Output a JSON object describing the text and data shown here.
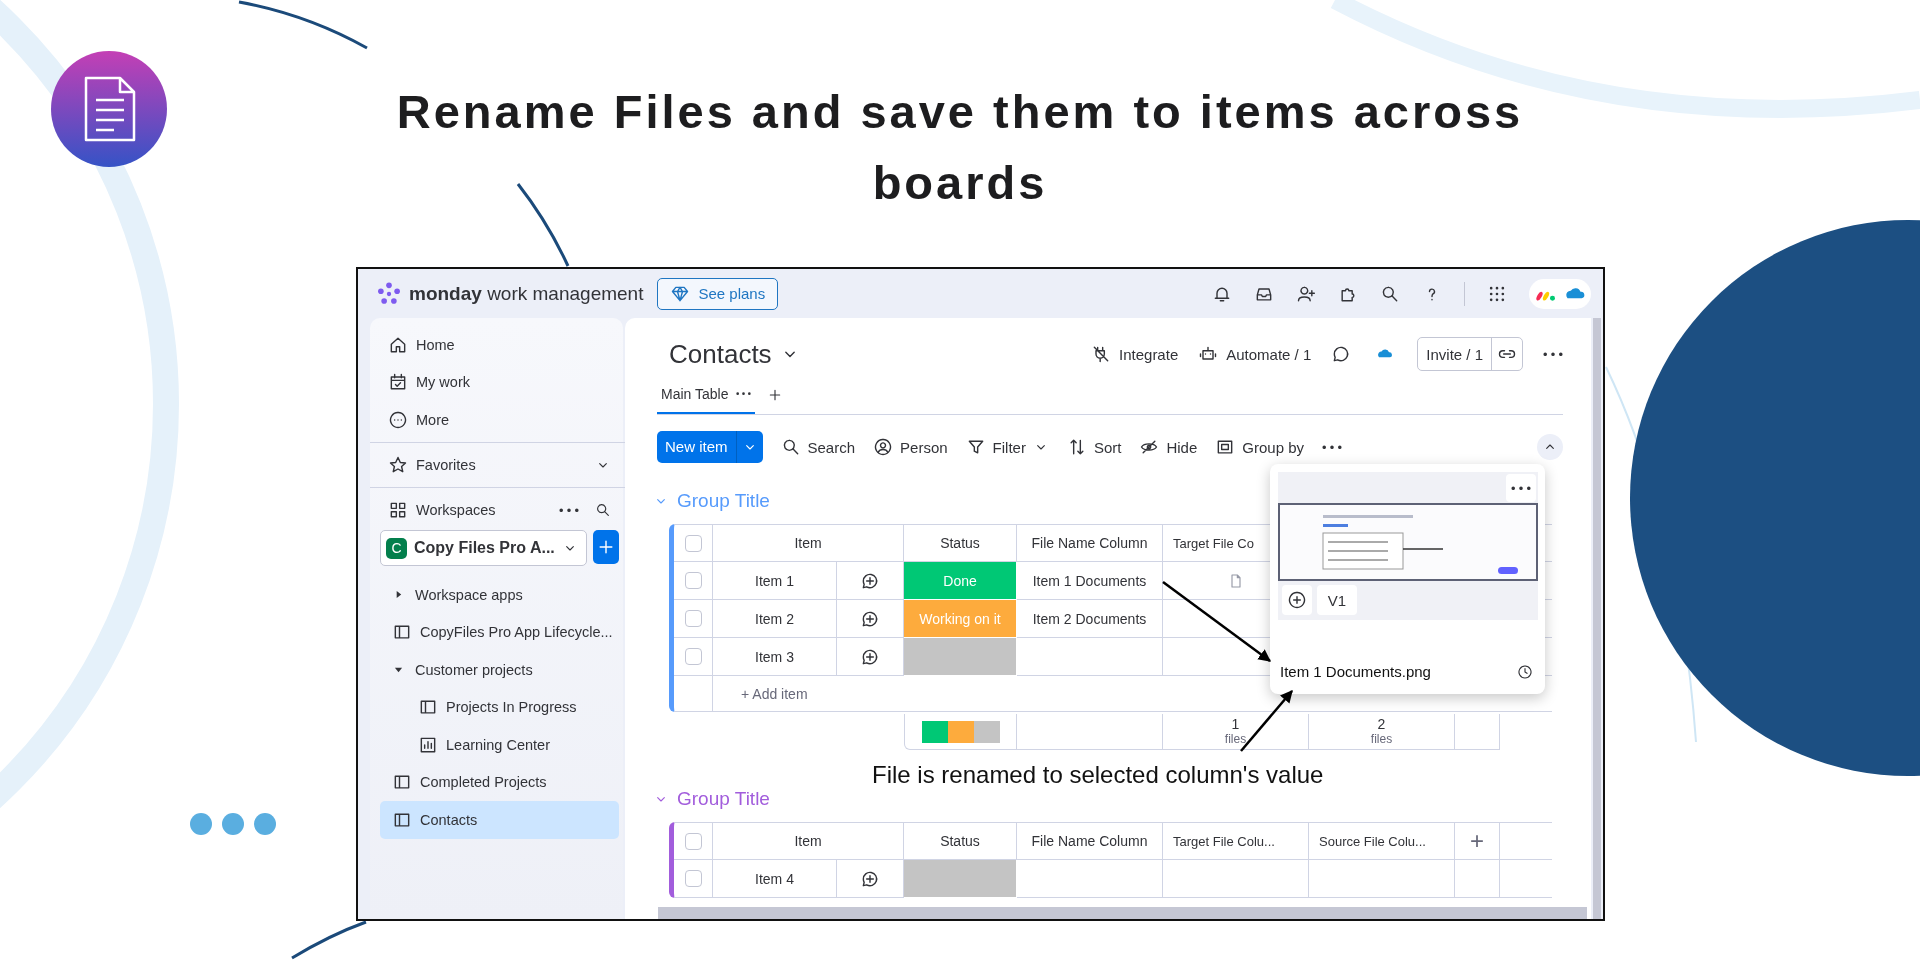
{
  "headline": "Rename Files and save them to items across boards",
  "topbar": {
    "brand": "**monday** work management",
    "plans_button": "See plans"
  },
  "sidebar": {
    "nav": [
      {
        "label": "Home"
      },
      {
        "label": "My work"
      },
      {
        "label": "More"
      }
    ],
    "favorites": {
      "label": "Favorites",
      "expanded": false
    },
    "workspaces": {
      "label": "Workspaces"
    },
    "workspace": {
      "initial": "C",
      "name": "Copy Files Pro A..."
    },
    "items": [
      {
        "label": "Workspace apps",
        "kind": "folder",
        "expanded": false,
        "selected": false
      },
      {
        "label": "CopyFiles Pro App Lifecycle...",
        "kind": "board",
        "selected": false
      },
      {
        "label": "Customer projects",
        "kind": "folder",
        "expanded": true,
        "selected": false,
        "children": [
          {
            "label": "Projects In Progress",
            "kind": "board",
            "selected": false
          },
          {
            "label": "Learning Center",
            "kind": "dashboard",
            "selected": false
          }
        ]
      },
      {
        "label": "Completed Projects",
        "kind": "board",
        "selected": false
      },
      {
        "label": "Contacts",
        "kind": "board",
        "selected": true
      }
    ]
  },
  "board": {
    "title": "Contacts",
    "actions": [
      "Integrate",
      "Automate / 1"
    ],
    "invite": "Invite / 1",
    "tabs": [
      {
        "label": "Main Table",
        "selected": true
      }
    ],
    "new_item": "New item",
    "toolbar": [
      {
        "label": "Search",
        "dropdown": false
      },
      {
        "label": "Person",
        "dropdown": false
      },
      {
        "label": "Filter",
        "dropdown": true
      },
      {
        "label": "Sort",
        "dropdown": false
      },
      {
        "label": "Hide",
        "dropdown": false
      },
      {
        "label": "Group by",
        "dropdown": false
      }
    ]
  },
  "groups": [
    {
      "title": "Group Title",
      "color": "#579bfc",
      "all_checked": false,
      "columns": [
        "Item",
        "Status",
        "File Name Column",
        "Target File Co"
      ],
      "rows": [
        {
          "item": "Item 1",
          "checked": false,
          "status": {
            "label": "Done",
            "color": "#00c875"
          },
          "file_name": "Item 1 Documents",
          "has_file": true
        },
        {
          "item": "Item 2",
          "checked": false,
          "status": {
            "label": "Working on it",
            "color": "#fdab3d"
          },
          "file_name": "Item 2 Documents",
          "has_file": false
        },
        {
          "item": "Item 3",
          "checked": false,
          "status": {
            "color": "#c4c4c4"
          },
          "has_file": false
        }
      ],
      "add_item": "+ Add item",
      "summary": {
        "counts": [
          {
            "value": "1",
            "unit": "files"
          },
          {
            "value": "2",
            "unit": "files"
          }
        ]
      }
    },
    {
      "title": "Group Title",
      "color": "#a25ddc",
      "all_checked": false,
      "add_column": "+",
      "columns": [
        "Item",
        "Status",
        "File Name Column",
        "Target File Colu...",
        "Source File Colu..."
      ],
      "rows": [
        {
          "item": "Item 4",
          "checked": false,
          "status": {
            "color": "#c4c4c4"
          },
          "has_file": false
        }
      ]
    }
  ],
  "annotation": "File is renamed to selected column's value",
  "file_preview": {
    "version": "V1",
    "filename": "Item 1 Documents.png"
  }
}
